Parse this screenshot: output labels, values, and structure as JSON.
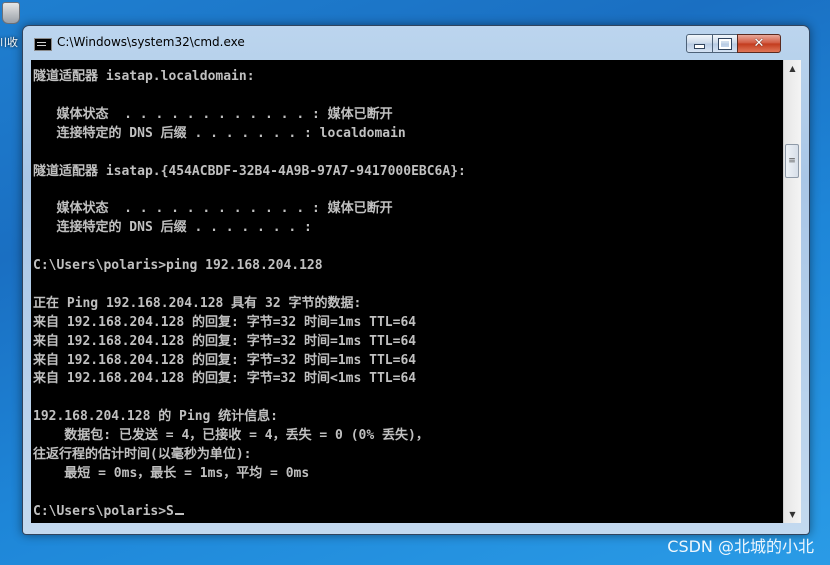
{
  "desktop": {
    "icon_label": "川收"
  },
  "window": {
    "title": "C:\\Windows\\system32\\cmd.exe",
    "minimize_glyph": "",
    "maximize_glyph": "",
    "close_glyph": "✕"
  },
  "console": {
    "lines": [
      "隧道适配器 isatap.localdomain:",
      "",
      "   媒体状态  . . . . . . . . . . . . : 媒体已断开",
      "   连接特定的 DNS 后缀 . . . . . . . : localdomain",
      "",
      "隧道适配器 isatap.{454ACBDF-32B4-4A9B-97A7-9417000EBC6A}:",
      "",
      "   媒体状态  . . . . . . . . . . . . : 媒体已断开",
      "   连接特定的 DNS 后缀 . . . . . . . :",
      "",
      "C:\\Users\\polaris>ping 192.168.204.128",
      "",
      "正在 Ping 192.168.204.128 具有 32 字节的数据:",
      "来自 192.168.204.128 的回复: 字节=32 时间=1ms TTL=64",
      "来自 192.168.204.128 的回复: 字节=32 时间=1ms TTL=64",
      "来自 192.168.204.128 的回复: 字节=32 时间=1ms TTL=64",
      "来自 192.168.204.128 的回复: 字节=32 时间<1ms TTL=64",
      "",
      "192.168.204.128 的 Ping 统计信息:",
      "    数据包: 已发送 = 4，已接收 = 4，丢失 = 0 (0% 丢失)，",
      "往返行程的估计时间(以毫秒为单位):",
      "    最短 = 0ms，最长 = 1ms，平均 = 0ms",
      "",
      "C:\\Users\\polaris>S"
    ]
  },
  "scrollbar": {
    "up_glyph": "▲",
    "down_glyph": "▼",
    "thumb_glyph": "≡"
  },
  "watermark": "CSDN @北城的小北"
}
